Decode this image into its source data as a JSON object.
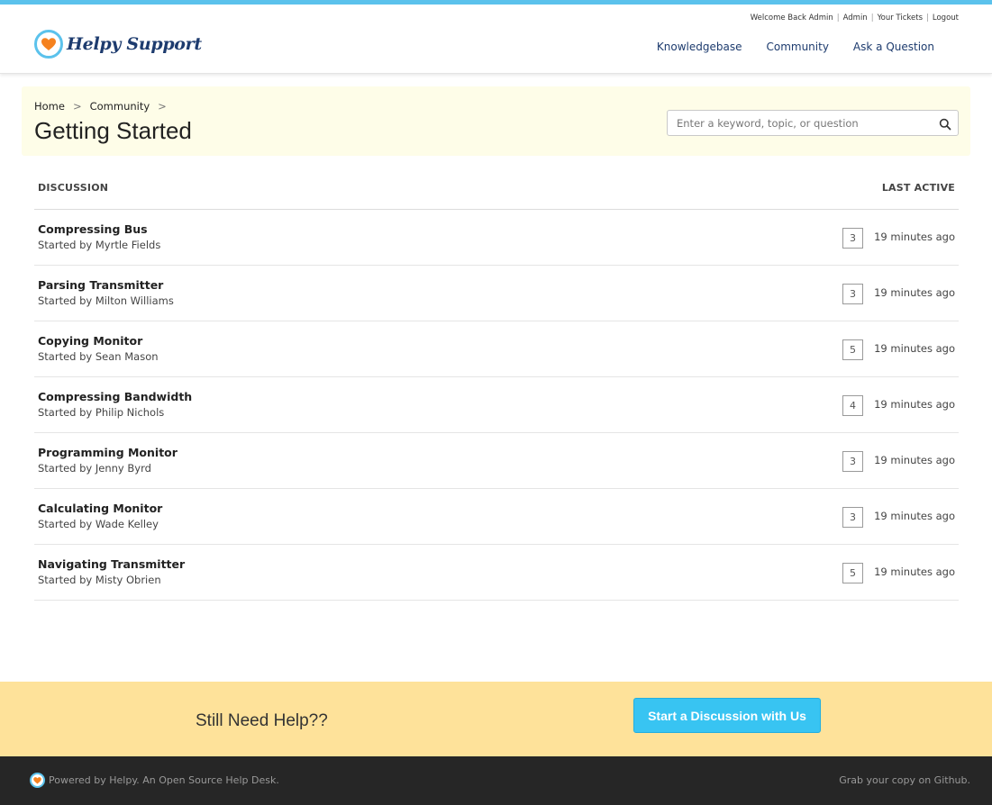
{
  "header": {
    "logo_text": "Helpy Support",
    "user_links": {
      "welcome": "Welcome Back Admin",
      "admin": "Admin",
      "tickets": "Your Tickets",
      "logout": "Logout"
    },
    "nav": {
      "knowledgebase": "Knowledgebase",
      "community": "Community",
      "ask": "Ask a Question"
    }
  },
  "hero": {
    "breadcrumb": {
      "home": "Home",
      "community": "Community"
    },
    "title": "Getting Started",
    "search_placeholder": "Enter a keyword, topic, or question"
  },
  "table": {
    "col_discussion": "DISCUSSION",
    "col_last_active": "LAST ACTIVE",
    "rows": [
      {
        "title": "Compressing Bus",
        "author": "Started by Myrtle Fields",
        "count": "3",
        "time": "19 minutes ago"
      },
      {
        "title": "Parsing Transmitter",
        "author": "Started by Milton Williams",
        "count": "3",
        "time": "19 minutes ago"
      },
      {
        "title": "Copying Monitor",
        "author": "Started by Sean Mason",
        "count": "5",
        "time": "19 minutes ago"
      },
      {
        "title": "Compressing Bandwidth",
        "author": "Started by Philip Nichols",
        "count": "4",
        "time": "19 minutes ago"
      },
      {
        "title": "Programming Monitor",
        "author": "Started by Jenny Byrd",
        "count": "3",
        "time": "19 minutes ago"
      },
      {
        "title": "Calculating Monitor",
        "author": "Started by Wade Kelley",
        "count": "3",
        "time": "19 minutes ago"
      },
      {
        "title": "Navigating Transmitter",
        "author": "Started by Misty Obrien",
        "count": "5",
        "time": "19 minutes ago"
      }
    ]
  },
  "cta": {
    "text": "Still Need Help??",
    "button": "Start a Discussion with Us"
  },
  "footer": {
    "left": "Powered by Helpy. An Open Source Help Desk.",
    "right": "Grab your copy on Github."
  },
  "colors": {
    "accent_blue": "#5bc2ec",
    "nav_text": "#1d3b6e",
    "heart": "#f5821f",
    "cta_band": "#fee29a",
    "cta_button": "#38c4f2",
    "hero_bg": "#fefde8",
    "footer_bg": "#262626"
  }
}
